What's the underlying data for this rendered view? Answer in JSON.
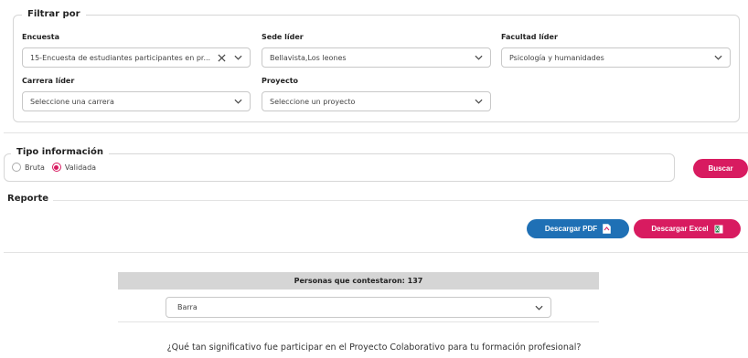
{
  "filters": {
    "legend": "Filtrar por",
    "encuesta": {
      "label": "Encuesta",
      "value": "15-Encuesta de estudiantes participantes en pr..."
    },
    "sede": {
      "label": "Sede líder",
      "value": "Bellavista,Los leones"
    },
    "facultad": {
      "label": "Facultad líder",
      "value": "Psicología y humanidades"
    },
    "carrera": {
      "label": "Carrera líder",
      "placeholder": "Seleccione una carrera"
    },
    "proyecto": {
      "label": "Proyecto",
      "placeholder": "Seleccione un proyecto"
    }
  },
  "tipo": {
    "legend": "Tipo información",
    "options": [
      {
        "label": "Bruta",
        "selected": false
      },
      {
        "label": "Validada",
        "selected": true
      }
    ],
    "accent": "#d81b60"
  },
  "actions": {
    "buscar": "Buscar"
  },
  "reporte": {
    "title": "Reporte",
    "pdf_label": "Descargar PDF",
    "excel_label": "Descargar Excel",
    "pdf_icon": "pdf-file-icon",
    "excel_icon": "excel-file-icon"
  },
  "summary": {
    "respondents": "Personas que contestaron: 137",
    "chart_type": "Barra",
    "question": "¿Qué tan significativo fue participar en el Proyecto Colaborativo para tu formación profesional?"
  },
  "colors": {
    "primary_pink": "#d81b60",
    "primary_blue": "#1f70b5",
    "bar_grey": "#d5d5d5"
  }
}
